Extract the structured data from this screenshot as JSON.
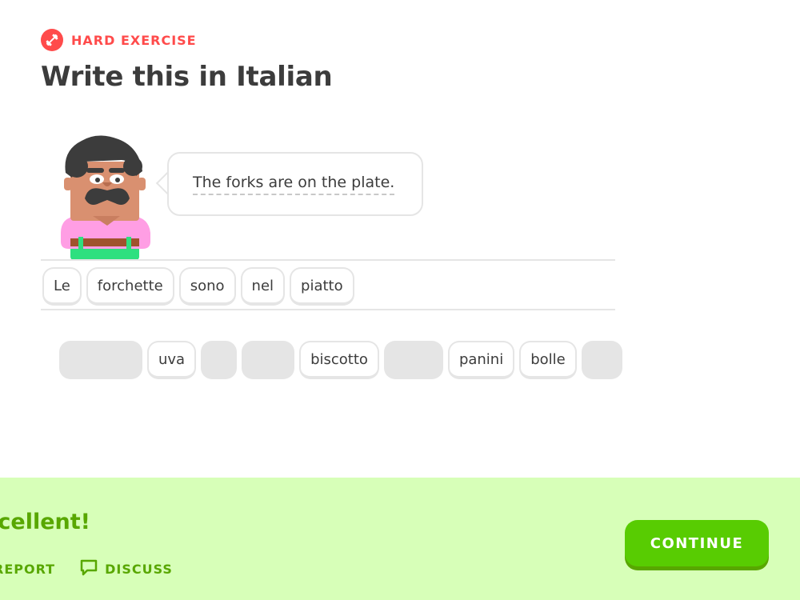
{
  "header": {
    "badge_label": "HARD EXERCISE",
    "badge_icon": "dumbbell-icon",
    "title": "Write this in Italian"
  },
  "prompt": {
    "sentence": "The forks are on the plate."
  },
  "answer": {
    "tiles": [
      "Le",
      "forchette",
      "sono",
      "nel",
      "piatto"
    ]
  },
  "word_bank": {
    "items": [
      {
        "text": "",
        "empty": true
      },
      {
        "text": "uva",
        "empty": false
      },
      {
        "text": "",
        "empty": true
      },
      {
        "text": "",
        "empty": true
      },
      {
        "text": "biscotto",
        "empty": false
      },
      {
        "text": "",
        "empty": true
      },
      {
        "text": "panini",
        "empty": false
      },
      {
        "text": "bolle",
        "empty": false
      },
      {
        "text": "",
        "empty": true
      }
    ]
  },
  "footer": {
    "result": "xcellent!",
    "report_label": "REPORT",
    "discuss_label": "DISCUSS",
    "continue_label": "CONTINUE"
  },
  "colors": {
    "accent_red": "#ff4b4b",
    "success_green": "#58cc02",
    "success_dark": "#58a700",
    "footer_bg": "#d7ffb8",
    "tile_border": "#e5e5e5"
  }
}
